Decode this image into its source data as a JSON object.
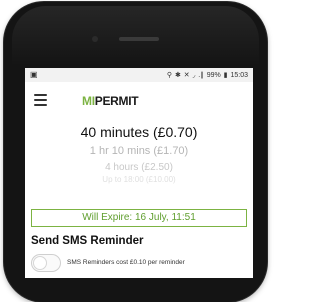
{
  "statusbar": {
    "left_icon": "image-notification-icon",
    "right_text": "⚲ ✱ ✕ ◞ .∥ 99% ▮ 15:03",
    "battery": "99%",
    "time": "15:03"
  },
  "appbar": {
    "menu_icon": "hamburger-icon",
    "logo_mi": "MI",
    "logo_permit": "PERMIT"
  },
  "duration_picker": {
    "options": [
      "40 minutes (£0.70)",
      "1 hr 10 mins (£1.70)",
      "4 hours (£2.50)",
      "Up to 18:00 (£10.00)"
    ],
    "selected_index": 0
  },
  "expiry": {
    "text": "Will Expire: 16 July, 11:51"
  },
  "sms": {
    "heading": "Send SMS Reminder",
    "toggle_on": false,
    "note": "SMS Reminders cost £0.10 per reminder"
  },
  "colors": {
    "accent_green": "#7cb342",
    "expire_text_green": "#5f9e2e",
    "phone_body": "#141414"
  }
}
